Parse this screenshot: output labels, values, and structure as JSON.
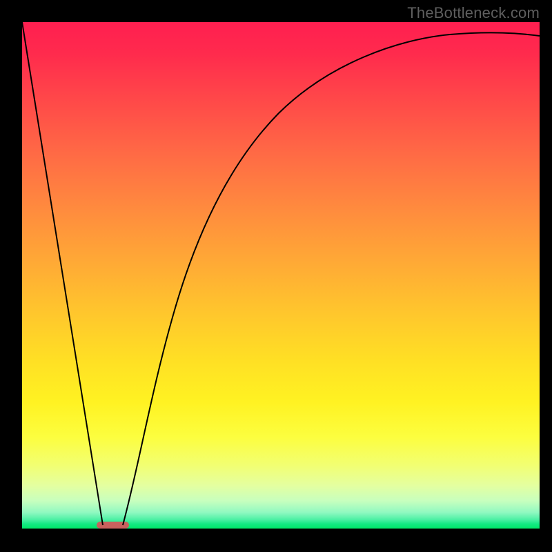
{
  "watermark": "TheBottleneck.com",
  "colors": {
    "frame": "#000000",
    "watermark": "#5f5f5f",
    "curve": "#000000",
    "marker": "#c9615e",
    "gradient_top": "#ff1f50",
    "gradient_bottom": "#00e768"
  },
  "chart_data": {
    "type": "line",
    "title": "",
    "xlabel": "",
    "ylabel": "",
    "xlim": [
      0,
      100
    ],
    "ylim": [
      0,
      100
    ],
    "optimum_x": 17,
    "series": [
      {
        "name": "left-branch",
        "x": [
          0,
          2,
          4,
          6,
          8,
          10,
          12,
          14,
          15,
          15.6
        ],
        "y": [
          100,
          87,
          75,
          62,
          50,
          37,
          25,
          12,
          4,
          0
        ]
      },
      {
        "name": "right-branch",
        "x": [
          19.5,
          22,
          25,
          28,
          32,
          36,
          40,
          45,
          50,
          55,
          60,
          65,
          70,
          75,
          80,
          85,
          90,
          95,
          100
        ],
        "y": [
          0,
          10,
          22,
          33,
          45,
          55,
          63,
          71,
          77,
          82,
          86,
          89,
          91,
          93,
          94.5,
          95.5,
          96.3,
          96.8,
          97.2
        ]
      }
    ],
    "background": {
      "type": "vertical-gradient",
      "stops": [
        {
          "pos": 0.0,
          "color": "#ff1f50"
        },
        {
          "pos": 0.5,
          "color": "#ffab35"
        },
        {
          "pos": 0.78,
          "color": "#fbfe30"
        },
        {
          "pos": 0.95,
          "color": "#b4ffb4"
        },
        {
          "pos": 1.0,
          "color": "#00e768"
        }
      ]
    },
    "marker": {
      "x_range": [
        14.4,
        20.6
      ],
      "y": 0
    }
  }
}
